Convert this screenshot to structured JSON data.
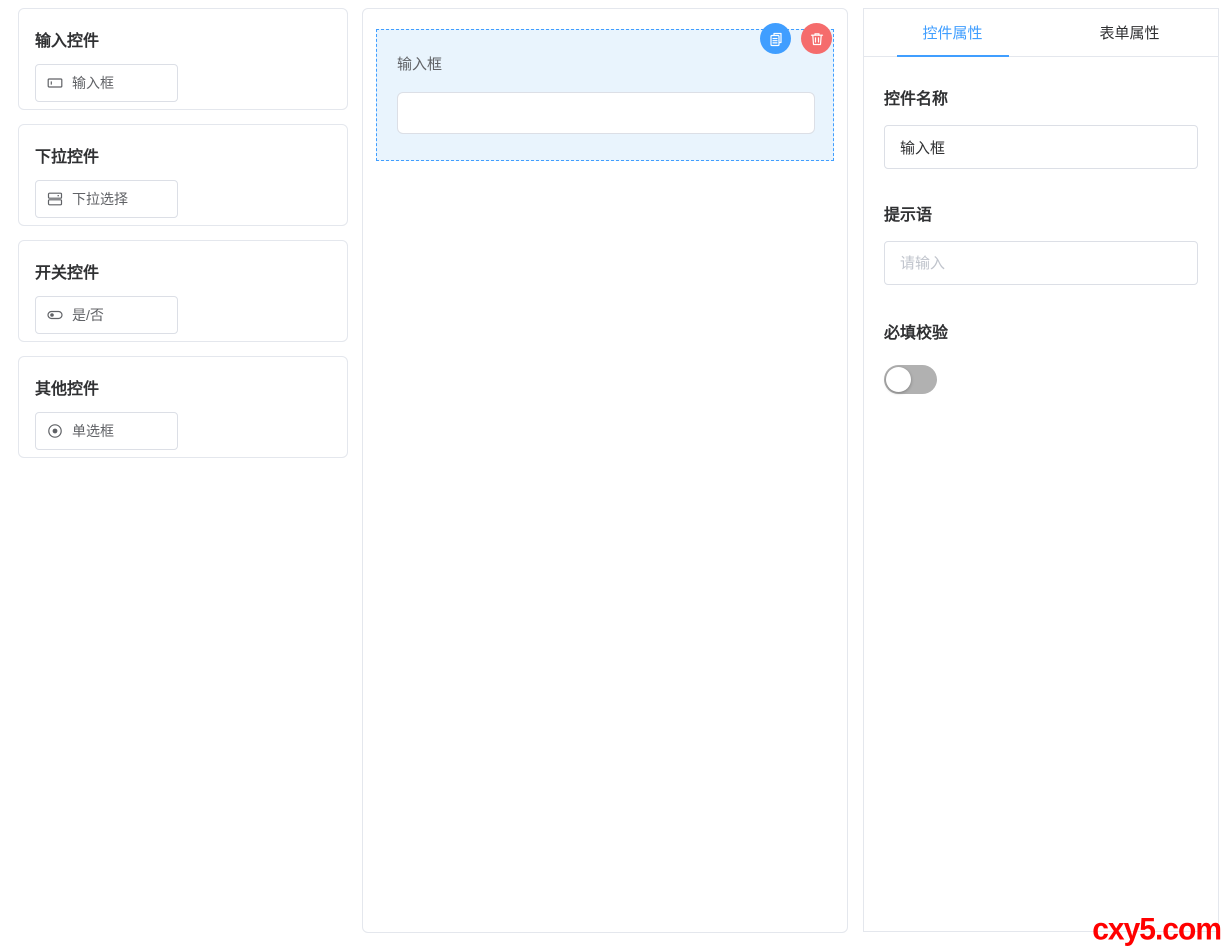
{
  "palette": {
    "groups": [
      {
        "title": "输入控件",
        "items": [
          {
            "label": "输入框",
            "icon": "input-box-icon"
          }
        ]
      },
      {
        "title": "下拉控件",
        "items": [
          {
            "label": "下拉选择",
            "icon": "select-icon"
          }
        ]
      },
      {
        "title": "开关控件",
        "items": [
          {
            "label": "是/否",
            "icon": "switch-icon"
          }
        ]
      },
      {
        "title": "其他控件",
        "items": [
          {
            "label": "单选框",
            "icon": "radio-icon"
          }
        ]
      }
    ]
  },
  "canvas": {
    "widget": {
      "label": "输入框",
      "value": "",
      "selected": true,
      "actions": [
        {
          "name": "copy",
          "icon": "copy-icon"
        },
        {
          "name": "delete",
          "icon": "trash-icon"
        }
      ]
    }
  },
  "properties": {
    "tabs": [
      {
        "label": "控件属性",
        "active": true
      },
      {
        "label": "表单属性",
        "active": false
      }
    ],
    "fields": [
      {
        "label": "控件名称",
        "value": "输入框"
      },
      {
        "label": "提示语",
        "value": "",
        "placeholder": "请输入"
      },
      {
        "label": "必填校验",
        "type": "switch",
        "value": false
      }
    ]
  },
  "watermark": "cxy5.com",
  "colors": {
    "accent": "#409eff",
    "danger": "#f56c6c",
    "selected_bg": "#e9f4fd",
    "panel_border": "#e4e7ed",
    "input_border": "#dcdfe6",
    "text_primary": "#303133",
    "text_secondary": "#606266",
    "placeholder": "#c0c4cc",
    "switch_off": "#b1b1b1",
    "watermark": "#ff0000"
  }
}
